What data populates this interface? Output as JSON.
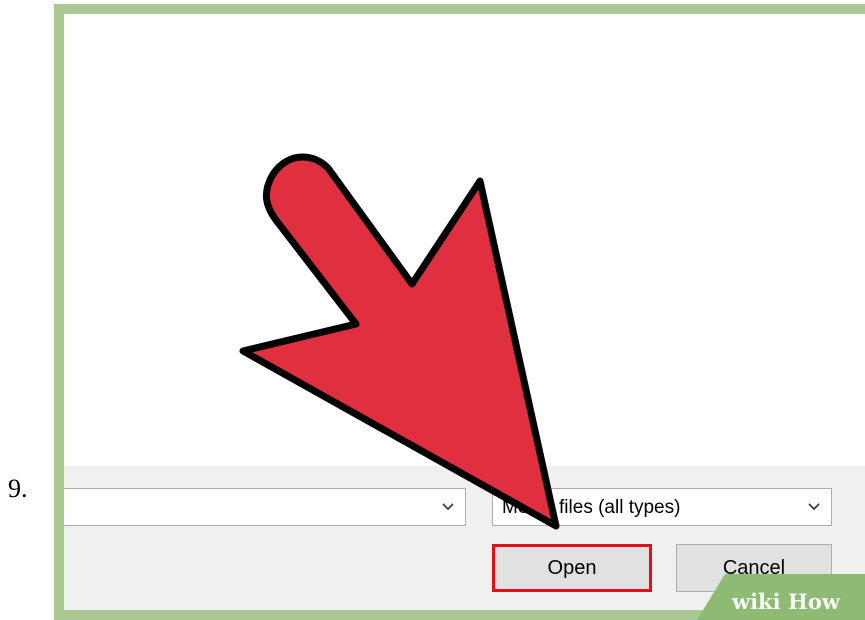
{
  "step": {
    "number": "9."
  },
  "dialog": {
    "filename_value": "",
    "filetype_selected": "Media files (all types)",
    "open_label": "Open",
    "cancel_label": "Cancel"
  },
  "annotation": {
    "arrow_icon": "pointer-arrow-icon",
    "arrow_color": "#e03040",
    "highlight_color": "#e3101c"
  },
  "watermark": {
    "wiki": "wiki",
    "how": "How"
  },
  "colors": {
    "frame": "#aac992",
    "bottom_bar": "#f0f0f0",
    "button": "#e1e1e1"
  }
}
